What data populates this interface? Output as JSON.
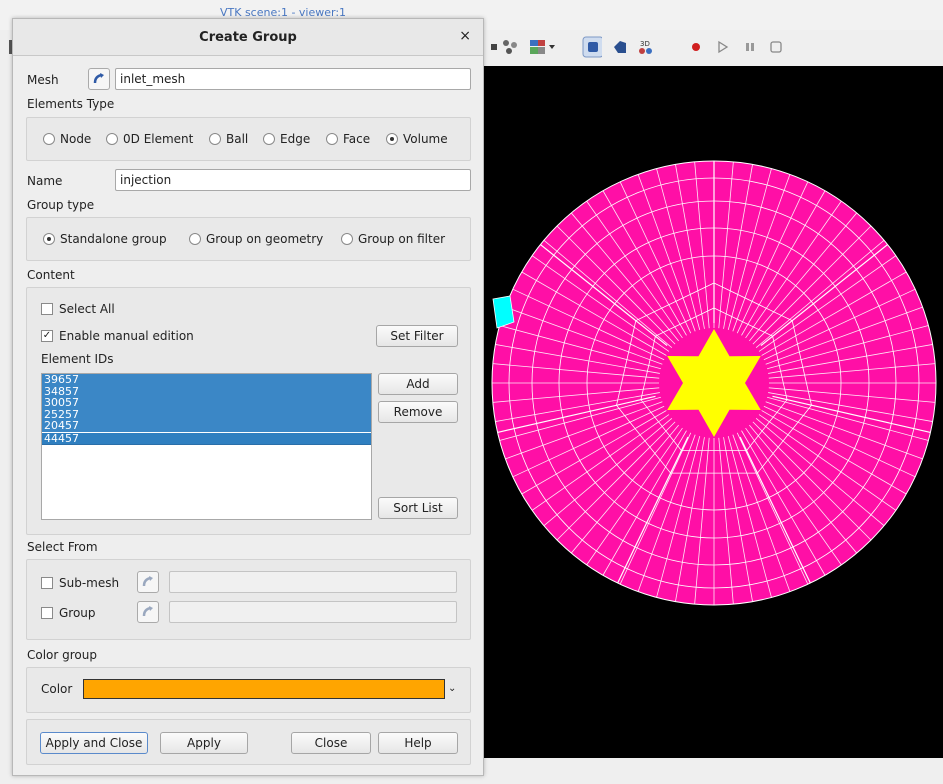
{
  "background": {
    "window_title": "VTK scene:1 - viewer:1",
    "toolbar_icons": [
      "view-icon",
      "axes-icon",
      "display-mode-icon",
      "shaded-box-icon",
      "shaded-icon",
      "3d-icon",
      "record-icon",
      "play-icon",
      "pause-icon",
      "stop-icon"
    ]
  },
  "dialog": {
    "title": "Create Group",
    "close_symbol": "×",
    "mesh_label": "Mesh",
    "mesh_value": "inlet_mesh",
    "elements_type_label": "Elements Type",
    "elements_types": [
      {
        "label": "Node",
        "checked": false
      },
      {
        "label": "0D Element",
        "checked": false
      },
      {
        "label": "Ball",
        "checked": false
      },
      {
        "label": "Edge",
        "checked": false
      },
      {
        "label": "Face",
        "checked": false
      },
      {
        "label": "Volume",
        "checked": true
      }
    ],
    "name_label": "Name",
    "name_value": "injection",
    "group_type_label": "Group type",
    "group_types": [
      {
        "label": "Standalone group",
        "checked": true
      },
      {
        "label": "Group on geometry",
        "checked": false
      },
      {
        "label": "Group on filter",
        "checked": false
      }
    ],
    "content_label": "Content",
    "select_all_label": "Select All",
    "enable_manual_label": "Enable manual edition",
    "set_filter_label": "Set Filter",
    "element_ids_label": "Element IDs",
    "element_ids": [
      "39657",
      "34857",
      "30057",
      "25257",
      "20457",
      "44457"
    ],
    "add_label": "Add",
    "remove_label": "Remove",
    "sort_list_label": "Sort List",
    "select_from_label": "Select From",
    "submesh_label": "Sub-mesh",
    "group_label": "Group",
    "color_group_label": "Color group",
    "color_label": "Color",
    "color_value": "#ffa500",
    "apply_close_label": "Apply and Close",
    "apply_label": "Apply",
    "close_label": "Close",
    "help_label": "Help"
  },
  "viewer": {
    "mesh_color": "#ff0fa6",
    "star_color": "#ffff00",
    "highlight_color": "#00ffff",
    "background_color": "#000000"
  }
}
